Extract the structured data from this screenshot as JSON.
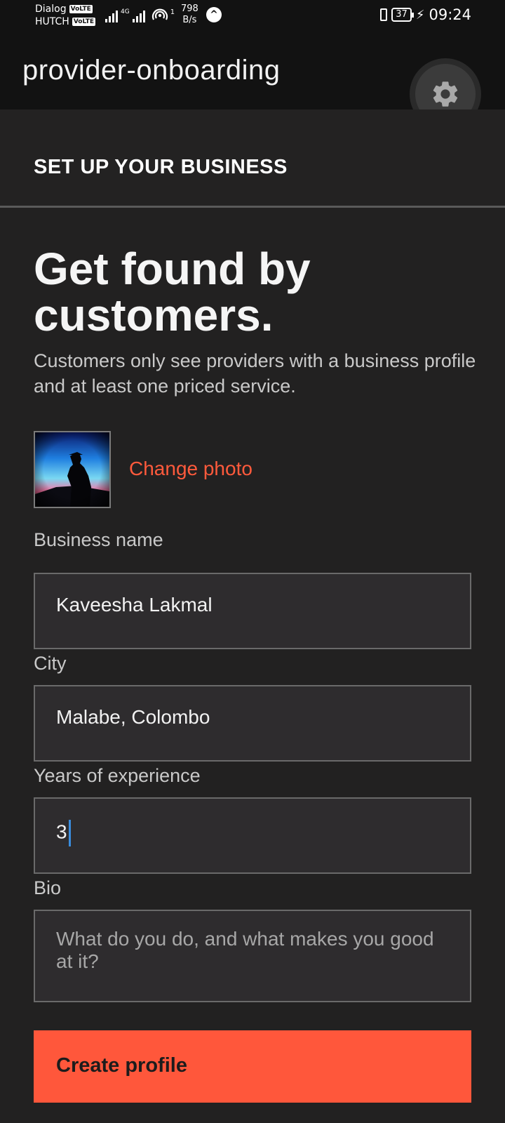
{
  "status_bar": {
    "carrier1": "Dialog",
    "carrier2": "HUTCH",
    "volte": "VoLTE",
    "net_type": "4G",
    "speed_value": "798",
    "speed_unit": "B/s",
    "hotspot_count": "1",
    "battery": "37",
    "time": "09:24"
  },
  "app_bar": {
    "title": "provider-onboarding",
    "settings_icon": "gear-icon"
  },
  "section": {
    "title": "SET UP YOUR BUSINESS"
  },
  "main": {
    "headline": "Get found by customers.",
    "subtext": "Customers only see providers with a business profile and at least one priced service.",
    "change_photo_label": "Change photo"
  },
  "form": {
    "business_name": {
      "label": "Business name",
      "value": "Kaveesha Lakmal"
    },
    "city": {
      "label": "City",
      "value": "Malabe, Colombo"
    },
    "experience": {
      "label": "Years of experience",
      "value": "3"
    },
    "bio": {
      "label": "Bio",
      "placeholder": "What do you do, and what makes you good at it?"
    }
  },
  "submit": {
    "label": "Create profile"
  },
  "colors": {
    "accent": "#ff573b",
    "background": "#222121",
    "appbar": "#121212"
  }
}
